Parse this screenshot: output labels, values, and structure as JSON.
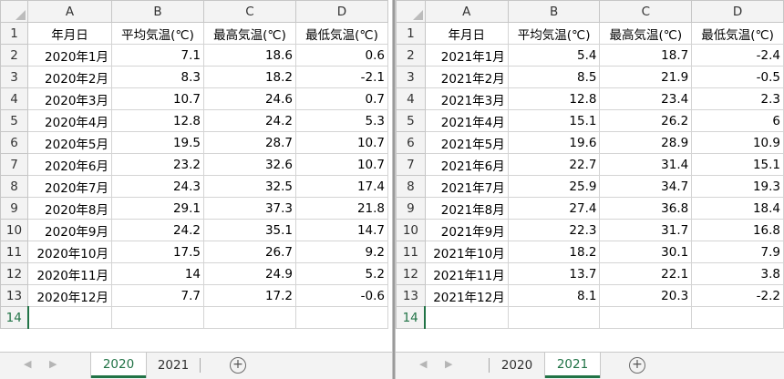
{
  "columns": [
    "A",
    "B",
    "C",
    "D"
  ],
  "header_row": {
    "row": "1",
    "date": "年月日",
    "avg": "平均気温(℃)",
    "high": "最高気温(℃)",
    "low": "最低気温(℃)"
  },
  "empty_row": "14",
  "panes": [
    {
      "rows": [
        {
          "row": "2",
          "date": "2020年1月",
          "avg": "7.1",
          "high": "18.6",
          "low": "0.6"
        },
        {
          "row": "3",
          "date": "2020年2月",
          "avg": "8.3",
          "high": "18.2",
          "low": "-2.1"
        },
        {
          "row": "4",
          "date": "2020年3月",
          "avg": "10.7",
          "high": "24.6",
          "low": "0.7"
        },
        {
          "row": "5",
          "date": "2020年4月",
          "avg": "12.8",
          "high": "24.2",
          "low": "5.3"
        },
        {
          "row": "6",
          "date": "2020年5月",
          "avg": "19.5",
          "high": "28.7",
          "low": "10.7"
        },
        {
          "row": "7",
          "date": "2020年6月",
          "avg": "23.2",
          "high": "32.6",
          "low": "10.7"
        },
        {
          "row": "8",
          "date": "2020年7月",
          "avg": "24.3",
          "high": "32.5",
          "low": "17.4"
        },
        {
          "row": "9",
          "date": "2020年8月",
          "avg": "29.1",
          "high": "37.3",
          "low": "21.8"
        },
        {
          "row": "10",
          "date": "2020年9月",
          "avg": "24.2",
          "high": "35.1",
          "low": "14.7"
        },
        {
          "row": "11",
          "date": "2020年10月",
          "avg": "17.5",
          "high": "26.7",
          "low": "9.2"
        },
        {
          "row": "12",
          "date": "2020年11月",
          "avg": "14",
          "high": "24.9",
          "low": "5.2"
        },
        {
          "row": "13",
          "date": "2020年12月",
          "avg": "7.7",
          "high": "17.2",
          "low": "-0.6"
        }
      ],
      "tabs": [
        {
          "label": "2020",
          "active": true
        },
        {
          "label": "2021",
          "active": false
        }
      ]
    },
    {
      "rows": [
        {
          "row": "2",
          "date": "2021年1月",
          "avg": "5.4",
          "high": "18.7",
          "low": "-2.4"
        },
        {
          "row": "3",
          "date": "2021年2月",
          "avg": "8.5",
          "high": "21.9",
          "low": "-0.5"
        },
        {
          "row": "4",
          "date": "2021年3月",
          "avg": "12.8",
          "high": "23.4",
          "low": "2.3"
        },
        {
          "row": "5",
          "date": "2021年4月",
          "avg": "15.1",
          "high": "26.2",
          "low": "6"
        },
        {
          "row": "6",
          "date": "2021年5月",
          "avg": "19.6",
          "high": "28.9",
          "low": "10.9"
        },
        {
          "row": "7",
          "date": "2021年6月",
          "avg": "22.7",
          "high": "31.4",
          "low": "15.1"
        },
        {
          "row": "8",
          "date": "2021年7月",
          "avg": "25.9",
          "high": "34.7",
          "low": "19.3"
        },
        {
          "row": "9",
          "date": "2021年8月",
          "avg": "27.4",
          "high": "36.8",
          "low": "18.4"
        },
        {
          "row": "10",
          "date": "2021年9月",
          "avg": "22.3",
          "high": "31.7",
          "low": "16.8"
        },
        {
          "row": "11",
          "date": "2021年10月",
          "avg": "18.2",
          "high": "30.1",
          "low": "7.9"
        },
        {
          "row": "12",
          "date": "2021年11月",
          "avg": "13.7",
          "high": "22.1",
          "low": "3.8"
        },
        {
          "row": "13",
          "date": "2021年12月",
          "avg": "8.1",
          "high": "20.3",
          "low": "-2.2"
        }
      ],
      "tabs": [
        {
          "label": "2020",
          "active": false
        },
        {
          "label": "2021",
          "active": true
        }
      ]
    }
  ],
  "controls": {
    "prev_icon": "◀",
    "next_icon": "▶",
    "add_sheet": "+"
  },
  "colors": {
    "accent": "#217346",
    "header_bg": "#f3f3f3",
    "gridline": "#d4d4d4"
  }
}
